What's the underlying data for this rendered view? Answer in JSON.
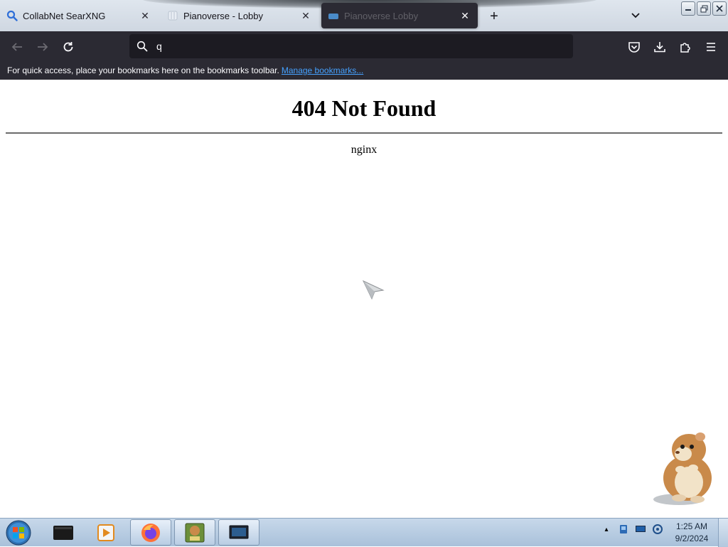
{
  "browser": {
    "tabs": [
      {
        "title": "CollabNet SearXNG",
        "favicon": "search-icon",
        "active": false
      },
      {
        "title": "Pianoverse - Lobby",
        "favicon": "piano-icon",
        "active": false
      },
      {
        "title": "Pianoverse Lobby",
        "favicon": "globe-icon",
        "active": true
      }
    ],
    "new_tab_label": "+",
    "url_value": "q",
    "bookmarks_text": "For quick access, place your bookmarks here on the bookmarks toolbar.",
    "bookmarks_link": "Manage bookmarks..."
  },
  "page": {
    "heading": "404 Not Found",
    "server": "nginx"
  },
  "taskbar": {
    "apps": [
      "terminal-icon",
      "media-player-icon",
      "firefox-icon",
      "game-box-icon",
      "monitor-icon"
    ],
    "clock_time": "1:25 AM",
    "clock_date": "9/2/2024",
    "tray_up_arrow": "▴"
  },
  "colors": {
    "toolbar": "#2b2a33",
    "urlbar": "#1c1b22",
    "link": "#45a1ff",
    "taskbar": "#b8cde3"
  }
}
